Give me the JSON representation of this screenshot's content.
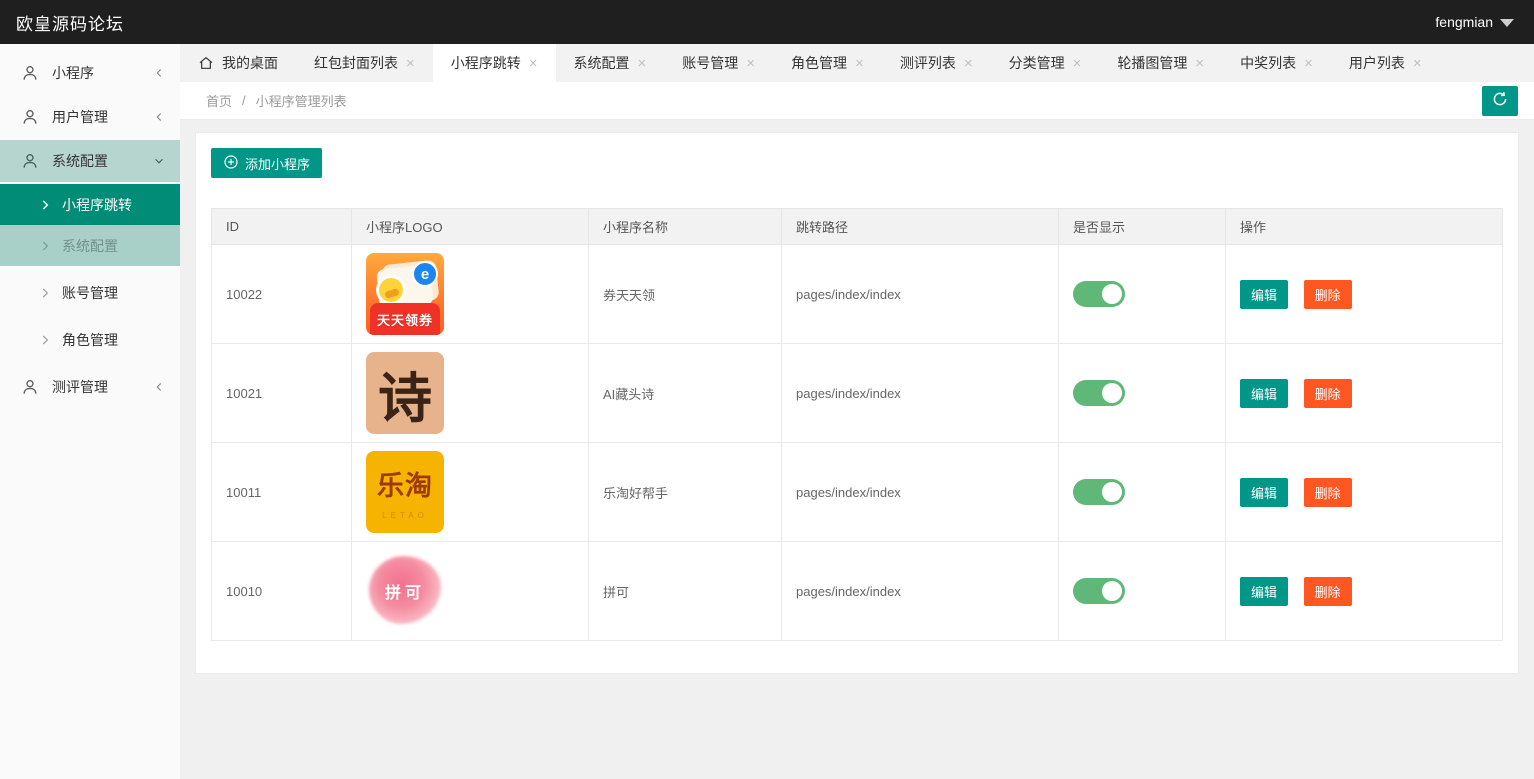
{
  "header": {
    "title": "欧皇源码论坛",
    "user": "fengmian"
  },
  "sidebar": {
    "items": [
      {
        "label": "小程序"
      },
      {
        "label": "用户管理"
      },
      {
        "label": "系统配置"
      },
      {
        "label": "测评管理"
      }
    ],
    "submenu": [
      {
        "label": "小程序跳转"
      },
      {
        "label": "系统配置"
      },
      {
        "label": "账号管理"
      },
      {
        "label": "角色管理"
      }
    ]
  },
  "tabs": [
    {
      "label": "我的桌面"
    },
    {
      "label": "红包封面列表"
    },
    {
      "label": "小程序跳转"
    },
    {
      "label": "系统配置"
    },
    {
      "label": "账号管理"
    },
    {
      "label": "角色管理"
    },
    {
      "label": "测评列表"
    },
    {
      "label": "分类管理"
    },
    {
      "label": "轮播图管理"
    },
    {
      "label": "中奖列表"
    },
    {
      "label": "用户列表"
    }
  ],
  "icons": {
    "close": "×"
  },
  "breadcrumb": {
    "home": "首页",
    "separator": "/",
    "current": "小程序管理列表"
  },
  "toolbar": {
    "add_label": "添加小程序"
  },
  "table": {
    "headers": [
      "ID",
      "小程序LOGO",
      "小程序名称",
      "跳转路径",
      "是否显示",
      "操作"
    ],
    "actions": {
      "edit": "编辑",
      "delete": "删除"
    },
    "rows": [
      {
        "id": "10022",
        "name": "券天天领",
        "path": "pages/index/index",
        "visible": true,
        "logo_text": "天天领券",
        "logo_badge": "e"
      },
      {
        "id": "10021",
        "name": "AI藏头诗",
        "path": "pages/index/index",
        "visible": true,
        "logo_text": "诗"
      },
      {
        "id": "10011",
        "name": "乐淘好帮手",
        "path": "pages/index/index",
        "visible": true,
        "logo_text": "乐淘",
        "logo_subtext": "LETAO"
      },
      {
        "id": "10010",
        "name": "拼可",
        "path": "pages/index/index",
        "visible": true,
        "logo_text": "拼可"
      }
    ]
  },
  "colors": {
    "accent": "#009688",
    "danger": "#FF5722",
    "toggle_on": "#5FB878",
    "sidebar_active": "#008c77",
    "header_bg": "#1f1f1f"
  }
}
